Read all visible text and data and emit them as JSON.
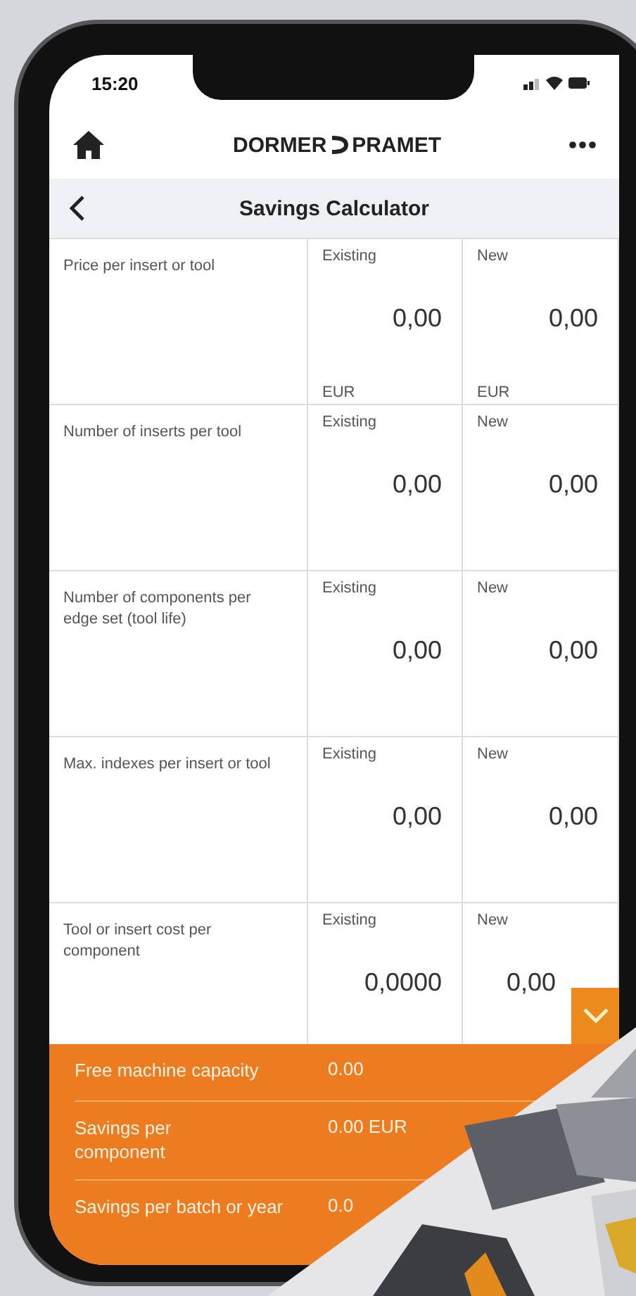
{
  "status_bar": {
    "time": "15:20"
  },
  "header": {
    "brand_left": "DORMER",
    "brand_right": "PRAMET"
  },
  "nav": {
    "title": "Savings Calculator"
  },
  "rows": [
    {
      "label": "Price per insert or tool",
      "existing": {
        "caption": "Existing",
        "value": "0,00",
        "unit": "EUR"
      },
      "new": {
        "caption": "New",
        "value": "0,00",
        "unit": "EUR"
      }
    },
    {
      "label": "Number of inserts per tool",
      "existing": {
        "caption": "Existing",
        "value": "0,00"
      },
      "new": {
        "caption": "New",
        "value": "0,00"
      }
    },
    {
      "label": "Number of components per edge set (tool life)",
      "existing": {
        "caption": "Existing",
        "value": "0,00"
      },
      "new": {
        "caption": "New",
        "value": "0,00"
      }
    },
    {
      "label": "Max. indexes per insert or tool",
      "existing": {
        "caption": "Existing",
        "value": "0,00"
      },
      "new": {
        "caption": "New",
        "value": "0,00"
      }
    },
    {
      "label": "Tool or insert cost per component",
      "existing": {
        "caption": "Existing",
        "value": "0,0000"
      },
      "new": {
        "caption": "New",
        "value": "0,00"
      }
    }
  ],
  "results": [
    {
      "label": "Free machine capacity",
      "value": "0.00"
    },
    {
      "label": "Savings per component",
      "value": "0.00 EUR"
    },
    {
      "label": "Savings per batch or year",
      "value": "0.0"
    }
  ]
}
